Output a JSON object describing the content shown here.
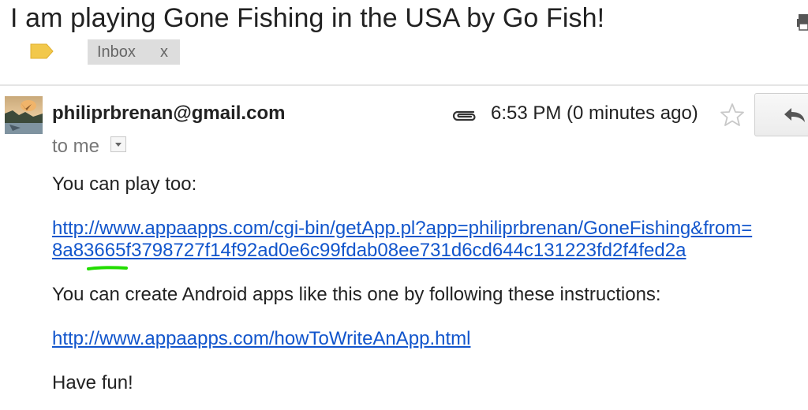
{
  "email": {
    "subject": "I am playing Gone Fishing in the USA by Go Fish!",
    "labels": [
      {
        "name": "Inbox",
        "remove": "x"
      }
    ],
    "sender": "philiprbrenan@gmail.com",
    "recipient_text": "to me",
    "timestamp": "6:53 PM (0 minutes ago)",
    "has_attachment": true,
    "starred": false
  },
  "body": {
    "line1": "You can play too:",
    "link1_line1": "http://www.appaapps.com/cgi-bin/getApp.pl?app=philiprbrenan/GoneFishing&from=",
    "link1_line2": "8a83665f3798727f14f92ad0e6c99fdab08ee731d6cd644c131223fd2f4fed2a",
    "line2": "You can create Android apps like this one by following these instructions:",
    "link2": "http://www.appaapps.com/howToWriteAnApp.html",
    "line3": "Have fun!"
  },
  "colors": {
    "link": "#1155cc",
    "label_tag": "#f2c84b",
    "chip_background": "#dddddd",
    "annotation_mark": "#22dd00"
  },
  "icons": {
    "label": "label-tag-icon",
    "attachment": "paperclip-icon",
    "star": "star-outline-icon",
    "reply": "reply-arrow-icon",
    "print": "print-icon"
  }
}
